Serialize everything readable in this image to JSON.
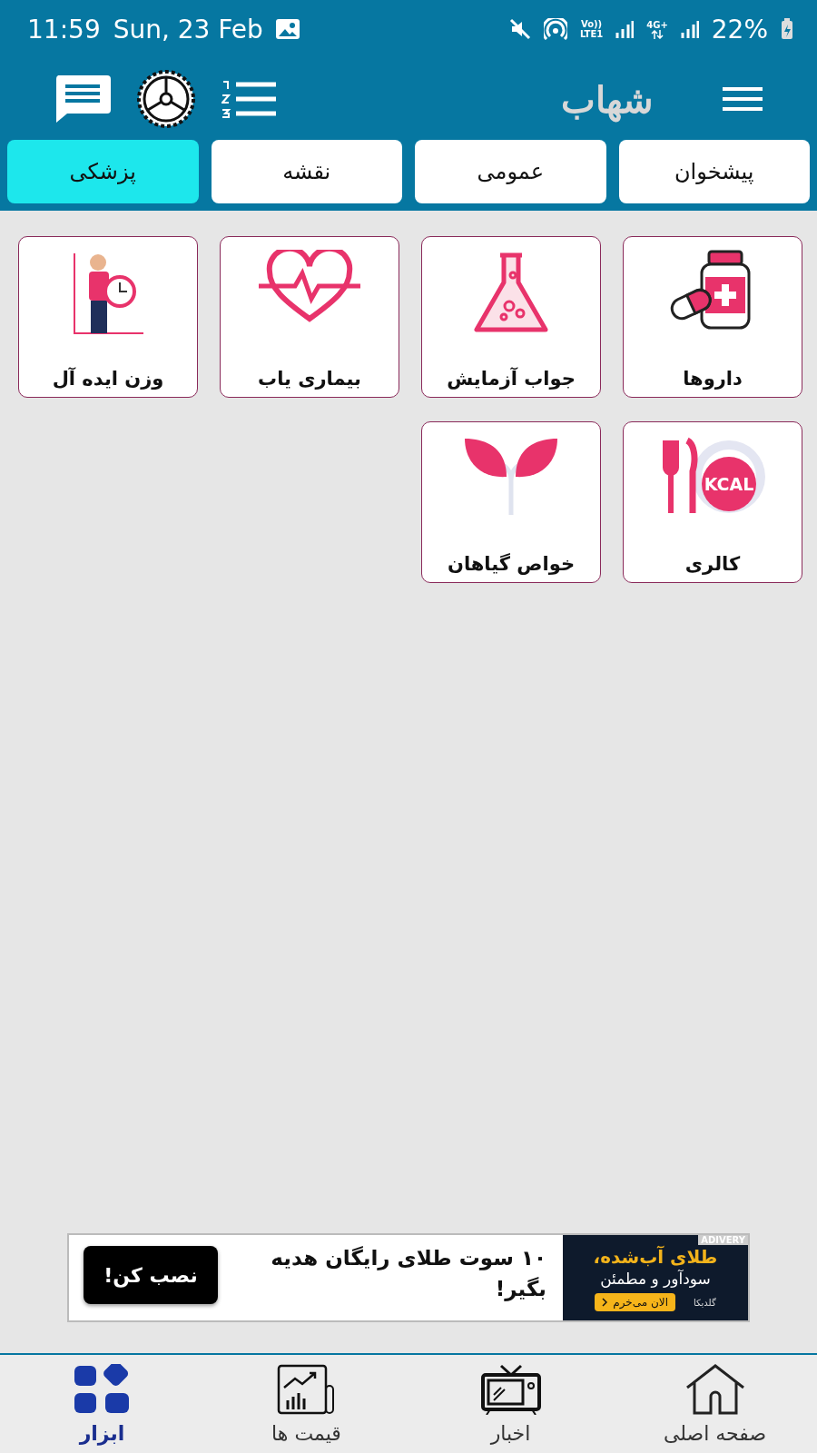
{
  "status_bar": {
    "time": "11:59",
    "date": "Sun, 23 Feb",
    "volte_top": "Vo))",
    "volte_bottom": "LTE1",
    "network": "4G+",
    "battery": "22%"
  },
  "header": {
    "logo": "شهاب"
  },
  "tabs": [
    {
      "label": "پیشخوان",
      "selected": false
    },
    {
      "label": "عمومی",
      "selected": false
    },
    {
      "label": "نقشه",
      "selected": false
    },
    {
      "label": "پزشکی",
      "selected": true
    }
  ],
  "tiles": [
    {
      "label": "داروها"
    },
    {
      "label": "جواب آزمایش"
    },
    {
      "label": "بیماری یاب"
    },
    {
      "label": "وزن ایده آل"
    },
    {
      "label": "کالری",
      "icon_text": "KCAL"
    },
    {
      "label": "خواص گیاهان"
    }
  ],
  "ad": {
    "headline": "۱۰ سوت طلای رایگان هدیه بگیر!",
    "button": "نصب کن!",
    "creative_title": "طلای آب‌شده،",
    "creative_subtitle": "سودآور و مطمئن",
    "creative_button": "الان می‌خرم",
    "creative_brand": "گلدیکا",
    "network": "ADIVERY"
  },
  "bottom_nav": [
    {
      "label": "صفحه اصلی",
      "selected": false
    },
    {
      "label": "اخبار",
      "selected": false
    },
    {
      "label": "قیمت ها",
      "selected": false
    },
    {
      "label": "ابزار",
      "selected": true
    }
  ]
}
